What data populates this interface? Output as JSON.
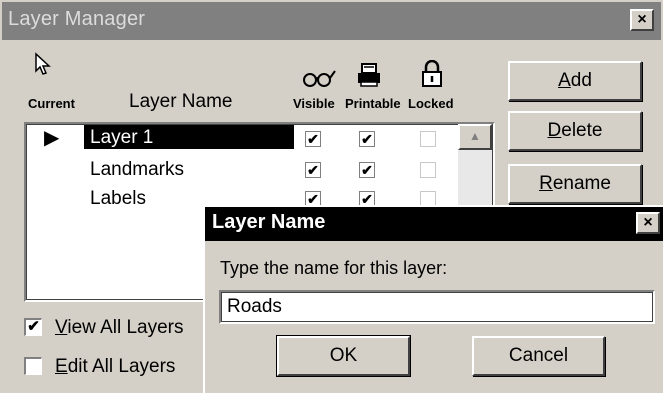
{
  "window": {
    "title": "Layer Manager",
    "close_glyph": "×"
  },
  "header": {
    "current_label": "Current",
    "layer_name_label": "Layer Name",
    "visible_label": "Visible",
    "printable_label": "Printable",
    "locked_label": "Locked"
  },
  "buttons": {
    "add": "Add",
    "delete": "Delete",
    "rename": "Rename"
  },
  "layers": [
    {
      "name": "Layer 1",
      "current": true,
      "visible": true,
      "printable": true,
      "locked": false,
      "selected": true
    },
    {
      "name": "Landmarks",
      "current": false,
      "visible": true,
      "printable": true,
      "locked": false,
      "selected": false
    },
    {
      "name": "Labels",
      "current": false,
      "visible": true,
      "printable": true,
      "locked": false,
      "selected": false
    }
  ],
  "options": {
    "view_all": "View All Layers",
    "view_all_checked": true,
    "edit_all": "Edit All Layers",
    "edit_all_checked": false
  },
  "dialog": {
    "title": "Layer Name",
    "prompt": "Type the name for this layer:",
    "input_value": "Roads",
    "ok": "OK",
    "cancel": "Cancel",
    "close_glyph": "×"
  },
  "glyphs": {
    "check": "✔",
    "current_marker": "▶",
    "scroll_up": "▲"
  }
}
